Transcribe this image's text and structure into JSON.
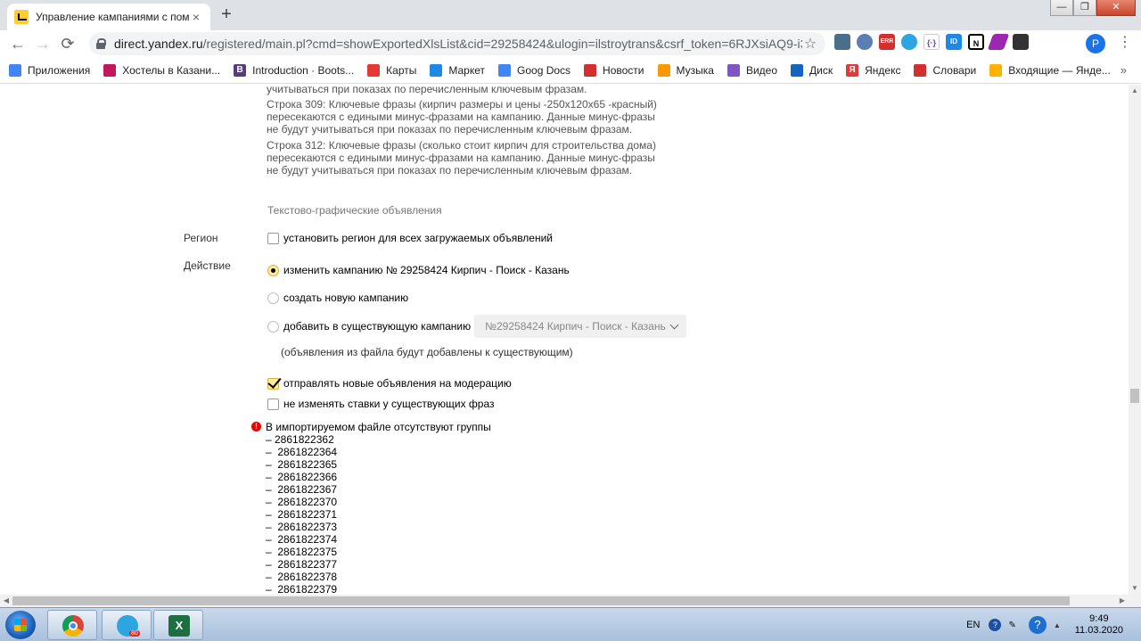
{
  "browser": {
    "tab_title": "Управление кампаниями с пом",
    "tab_close": "×",
    "new_tab": "+",
    "window_buttons": [
      "—",
      "❐",
      "✕"
    ],
    "url_host": "direct.yandex.ru",
    "url_path": "/registered/main.pl?cmd=showExportedXlsList&cid=29258424&ulogin=ilstroytrans&csrf_token=6RJXsiAQ9-i3etJ...",
    "profile_initial": "P",
    "extensions": [
      "ERR",
      "ID"
    ]
  },
  "bookmarks": [
    {
      "label": "Приложения",
      "icon": "apps-grid-icon",
      "color": "#4285f4"
    },
    {
      "label": "Хостелы в Казани...",
      "icon": "hostel-icon",
      "color": "#c2185b"
    },
    {
      "label": "Introduction · Boots...",
      "icon": "bootstrap-icon",
      "color": "#563d7c",
      "glyph": "B"
    },
    {
      "label": "Карты",
      "icon": "maps-pin-icon",
      "color": "#e53935"
    },
    {
      "label": "Маркет",
      "icon": "cart-icon",
      "color": "#1e88e5"
    },
    {
      "label": "Goog Docs",
      "icon": "docs-icon",
      "color": "#4285f4"
    },
    {
      "label": "Новости",
      "icon": "news-icon",
      "color": "#d32f2f"
    },
    {
      "label": "Музыка",
      "icon": "music-icon",
      "color": "#ff9800"
    },
    {
      "label": "Видео",
      "icon": "video-icon",
      "color": "#7e57c2"
    },
    {
      "label": "Диск",
      "icon": "disk-icon",
      "color": "#1565c0"
    },
    {
      "label": "Яндекс",
      "icon": "yandex-icon",
      "color": "#e53935",
      "glyph": "Я"
    },
    {
      "label": "Словари",
      "icon": "dictionary-icon",
      "color": "#d32f2f"
    },
    {
      "label": "Входящие — Янде...",
      "icon": "mail-icon",
      "color": "#ffb300"
    }
  ],
  "page": {
    "warnings": [
      "учитываться при показах по перечисленным ключевым фразам.",
      "Строка 309: Ключевые фразы (кирпич размеры и цены -250х120х65 -красный) пересекаются с едиными минус-фразами на кампанию. Данные минус-фразы не будут учитываться при показах по перечисленным ключевым фразам.",
      "Строка 312: Ключевые фразы (сколько стоит кирпич для строительства дома) пересекаются с едиными минус-фразами на кампанию. Данные минус-фразы не будут учитываться при показах по перечисленным ключевым фразам."
    ],
    "section_heading": "Текстово-графические объявления",
    "region_label": "Регион",
    "region_checkbox": "установить регион для всех загружаемых объявлений",
    "action_label": "Действие",
    "action_options": [
      "изменить кампанию № 29258424 Кирпич - Поиск - Казань",
      "создать новую кампанию",
      "добавить в существующую кампанию"
    ],
    "action_selected_index": 0,
    "campaign_select_value": "№29258424 Кирпич - Поиск - Казань",
    "add_note": "(объявления из файла будут добавлены к существующим)",
    "moderation_checkbox": "отправлять новые объявления на модерацию",
    "moderation_checked": true,
    "bids_checkbox": "не изменять ставки у существующих фраз",
    "bids_checked": false,
    "error_title": "В импортируемом файле отсутствуют группы",
    "missing_groups": [
      "– 2861822362",
      "–  2861822364",
      "–  2861822365",
      "–  2861822366",
      "–  2861822367",
      "–  2861822370",
      "–  2861822371",
      "–  2861822373",
      "–  2861822374",
      "–  2861822375",
      "–  2861822377",
      "–  2861822378",
      "–  2861822379"
    ]
  },
  "taskbar": {
    "apps": [
      "chrome",
      "telegram",
      "excel"
    ],
    "telegram_badge": "80",
    "language": "EN",
    "time": "9:49",
    "date": "11.03.2020"
  }
}
